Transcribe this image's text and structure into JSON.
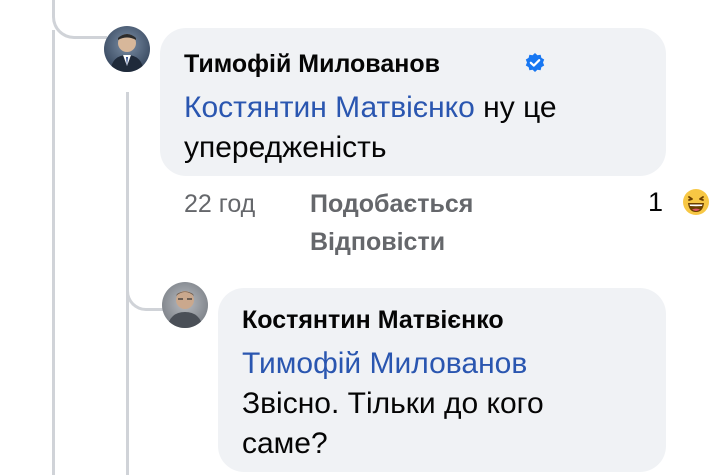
{
  "comments": [
    {
      "author": "Тимофій Милованов",
      "verified": true,
      "mention": "Костянтин Матвієнко",
      "text_line1": " ну це",
      "text_line2": "упередженість",
      "time": "22 год",
      "like_label": "Подобається",
      "reply_label": "Відповісти",
      "reaction_count": "1",
      "reaction_icon": "laughing-emoji-icon"
    },
    {
      "author": "Костянтин Матвієнко",
      "mention": "Тимофій Милованов",
      "text_line1": "Звісно. Тільки до кого",
      "text_line2": "саме?"
    }
  ],
  "colors": {
    "bubble_bg": "#f0f2f5",
    "mention": "#2a56b0",
    "meta_text": "#65676b",
    "verified": "#1877f2",
    "thread_line": "#d0d3d8"
  }
}
